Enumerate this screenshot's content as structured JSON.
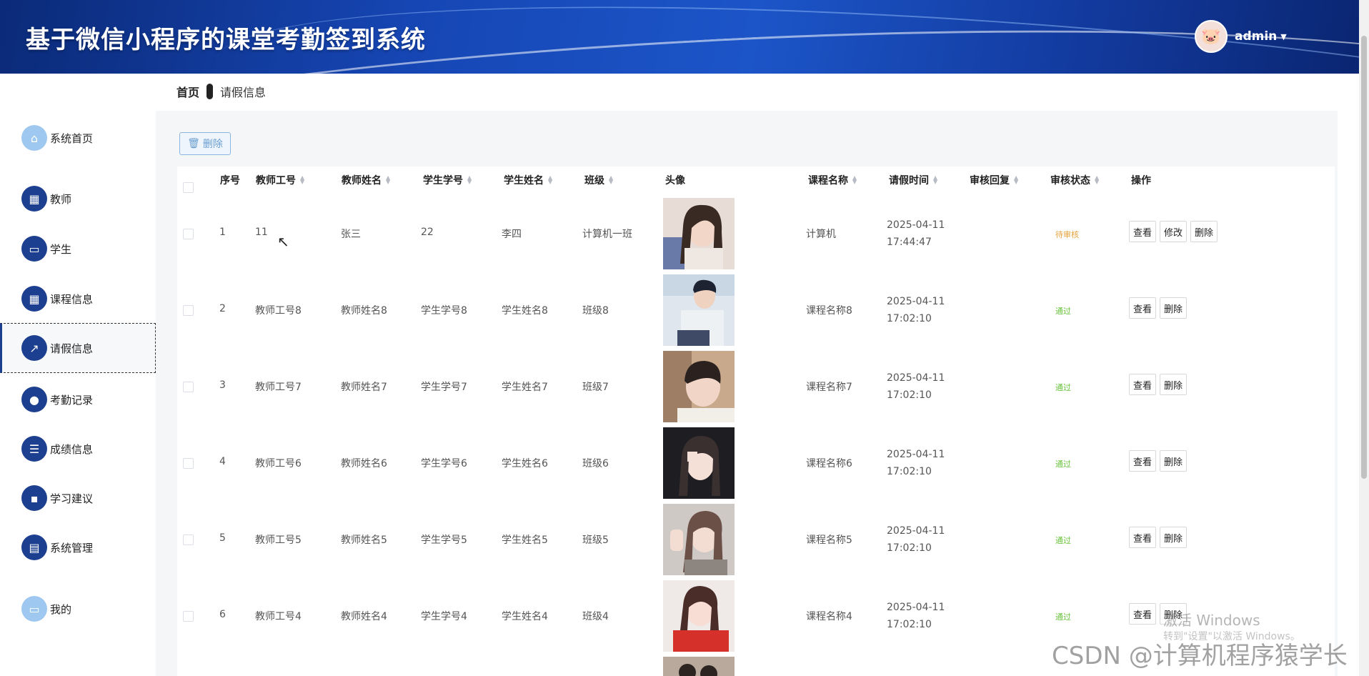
{
  "header": {
    "title": "基于微信小程序的课堂考勤签到系统",
    "username": "admin"
  },
  "breadcrumb": {
    "home": "首页",
    "current": "请假信息"
  },
  "sidebar": {
    "items": [
      {
        "label": "系统首页",
        "icon": "home-icon"
      },
      {
        "label": "教师",
        "icon": "grid-icon"
      },
      {
        "label": "学生",
        "icon": "monitor-icon"
      },
      {
        "label": "课程信息",
        "icon": "grid-icon"
      },
      {
        "label": "请假信息",
        "icon": "chart-icon"
      },
      {
        "label": "考勤记录",
        "icon": "user-icon"
      },
      {
        "label": "成绩信息",
        "icon": "sliders-icon"
      },
      {
        "label": "学习建议",
        "icon": "chat-icon"
      },
      {
        "label": "系统管理",
        "icon": "clipboard-icon"
      },
      {
        "label": "我的",
        "icon": "card-icon"
      }
    ]
  },
  "toolbar": {
    "delete_label": "删除"
  },
  "table": {
    "headers": [
      "序号",
      "教师工号",
      "教师姓名",
      "学生学号",
      "学生姓名",
      "班级",
      "头像",
      "课程名称",
      "请假时间",
      "审核回复",
      "审核状态",
      "操作"
    ],
    "rows": [
      {
        "no": "1",
        "teacher_id": "11",
        "teacher_name": "张三",
        "student_id": "22",
        "student_name": "李四",
        "class": "计算机一班",
        "course": "计算机",
        "time": "2025-04-11 17:44:47",
        "reply": "",
        "status": "待审核",
        "status_color": "#e6a23c",
        "ops": [
          "查看",
          "修改",
          "删除"
        ]
      },
      {
        "no": "2",
        "teacher_id": "教师工号8",
        "teacher_name": "教师姓名8",
        "student_id": "学生学号8",
        "student_name": "学生姓名8",
        "class": "班级8",
        "course": "课程名称8",
        "time": "2025-04-11 17:02:10",
        "reply": "",
        "status": "通过",
        "status_color": "#67c23a",
        "ops": [
          "查看",
          "删除"
        ]
      },
      {
        "no": "3",
        "teacher_id": "教师工号7",
        "teacher_name": "教师姓名7",
        "student_id": "学生学号7",
        "student_name": "学生姓名7",
        "class": "班级7",
        "course": "课程名称7",
        "time": "2025-04-11 17:02:10",
        "reply": "",
        "status": "通过",
        "status_color": "#67c23a",
        "ops": [
          "查看",
          "删除"
        ]
      },
      {
        "no": "4",
        "teacher_id": "教师工号6",
        "teacher_name": "教师姓名6",
        "student_id": "学生学号6",
        "student_name": "学生姓名6",
        "class": "班级6",
        "course": "课程名称6",
        "time": "2025-04-11 17:02:10",
        "reply": "",
        "status": "通过",
        "status_color": "#67c23a",
        "ops": [
          "查看",
          "删除"
        ]
      },
      {
        "no": "5",
        "teacher_id": "教师工号5",
        "teacher_name": "教师姓名5",
        "student_id": "学生学号5",
        "student_name": "学生姓名5",
        "class": "班级5",
        "course": "课程名称5",
        "time": "2025-04-11 17:02:10",
        "reply": "",
        "status": "通过",
        "status_color": "#67c23a",
        "ops": [
          "查看",
          "删除"
        ]
      },
      {
        "no": "6",
        "teacher_id": "教师工号4",
        "teacher_name": "教师姓名4",
        "student_id": "学生学号4",
        "student_name": "学生姓名4",
        "class": "班级4",
        "course": "课程名称4",
        "time": "2025-04-11 17:02:10",
        "reply": "",
        "status": "通过",
        "status_color": "#67c23a",
        "ops": [
          "查看",
          "删除"
        ]
      }
    ]
  },
  "watermarks": {
    "activate": "激活 Windows",
    "activate_hint": "转到\"设置\"以激活 Windows。",
    "csdn": "CSDN @计算机程序猿学长"
  },
  "colors": {
    "header_bg": "#1646b4",
    "nav_icon": "#1d3f8f",
    "status_pending": "#e6a23c",
    "status_pass": "#67c23a"
  }
}
